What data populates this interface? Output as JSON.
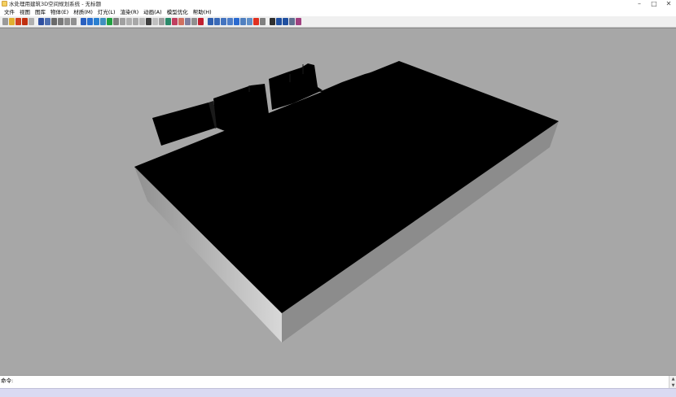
{
  "window": {
    "title": "水处理用建筑3D空间规划系统 - 无标题",
    "minimize_glyph": "–",
    "maximize_glyph": "□",
    "close_glyph": "✕"
  },
  "menu": {
    "items": [
      {
        "label": "文件"
      },
      {
        "label": "视图"
      },
      {
        "label": "图库"
      },
      {
        "label": "物体(E)"
      },
      {
        "label": "材质(M)"
      },
      {
        "label": "灯光(L)"
      },
      {
        "label": "渲染(R)"
      },
      {
        "label": "动画(A)"
      },
      {
        "label": "模型优化"
      },
      {
        "label": "帮助(H)"
      }
    ]
  },
  "toolbar": {
    "buttons": [
      {
        "icon": "new-icon",
        "color": "#9a9a9a"
      },
      {
        "icon": "open-icon",
        "color": "#e0b030"
      },
      {
        "icon": "play-icon",
        "color": "#d04020"
      },
      {
        "icon": "record-icon",
        "color": "#c03010"
      },
      {
        "icon": "stop-icon",
        "color": "#b0b0b0"
      },
      {
        "sep": true
      },
      {
        "icon": "select-icon",
        "color": "#3050a0"
      },
      {
        "icon": "copy-icon",
        "color": "#5070b0"
      },
      {
        "icon": "cut-icon",
        "color": "#6a6a6a"
      },
      {
        "icon": "paste-icon",
        "color": "#7a7a7a"
      },
      {
        "icon": "undo-icon",
        "color": "#909090"
      },
      {
        "icon": "redo-icon",
        "color": "#909090"
      },
      {
        "sep": true
      },
      {
        "icon": "move-icon",
        "color": "#2a60c0"
      },
      {
        "icon": "rotate-icon",
        "color": "#2a70d0"
      },
      {
        "icon": "scale-icon",
        "color": "#2a80d0"
      },
      {
        "icon": "align-icon",
        "color": "#4090c0"
      },
      {
        "icon": "group-icon",
        "color": "#20a040"
      },
      {
        "icon": "ungroup-icon",
        "color": "#808080"
      },
      {
        "icon": "box-icon",
        "color": "#a0a0a0"
      },
      {
        "icon": "cylinder-icon",
        "color": "#b0b0b0"
      },
      {
        "icon": "sphere-icon",
        "color": "#a8a8a8"
      },
      {
        "icon": "cone-icon",
        "color": "#b8b8b8"
      },
      {
        "icon": "cursor-icon",
        "color": "#404040"
      },
      {
        "icon": "light-icon",
        "color": "#c0c0c0"
      },
      {
        "icon": "camera-icon",
        "color": "#a0a0a0"
      },
      {
        "icon": "material-icon",
        "color": "#2a8a6a"
      },
      {
        "icon": "texture-icon",
        "color": "#c04060"
      },
      {
        "icon": "render-icon",
        "color": "#d07060"
      },
      {
        "icon": "animate-icon",
        "color": "#8080a0"
      },
      {
        "icon": "layer-icon",
        "color": "#909090"
      },
      {
        "icon": "paint-icon",
        "color": "#c02030"
      },
      {
        "sep": true
      },
      {
        "icon": "view-front-icon",
        "color": "#3060b0"
      },
      {
        "icon": "view-top-icon",
        "color": "#3a6ab8"
      },
      {
        "icon": "view-side-icon",
        "color": "#4474c0"
      },
      {
        "icon": "view-persp-icon",
        "color": "#4e7ec8"
      },
      {
        "icon": "globe-icon",
        "color": "#2a6ad0"
      },
      {
        "icon": "wire-icon",
        "color": "#5080c0"
      },
      {
        "icon": "shade-icon",
        "color": "#6090c8"
      },
      {
        "icon": "fill-icon",
        "color": "#e03020"
      },
      {
        "icon": "grid-icon",
        "color": "#808080"
      },
      {
        "sep": true
      },
      {
        "icon": "arrow-icon",
        "color": "#303030"
      },
      {
        "icon": "zoom-in-icon",
        "color": "#2050a0"
      },
      {
        "icon": "zoom-out-icon",
        "color": "#2050a0"
      },
      {
        "icon": "zoom-extents-icon",
        "color": "#607090"
      },
      {
        "icon": "pan-icon",
        "color": "#a04080"
      }
    ]
  },
  "viewport": {
    "background": "#a7a7a7",
    "scene_colors": {
      "top": "#000000",
      "front_face_light": "#d8d8d8",
      "front_face_dark": "#909090",
      "side_face": "#8c8c8c"
    }
  },
  "command": {
    "label": "命令:",
    "value": "",
    "scroll_up": "▲",
    "scroll_down": "▼"
  },
  "statusbar": {
    "color": "#dadaf2"
  }
}
